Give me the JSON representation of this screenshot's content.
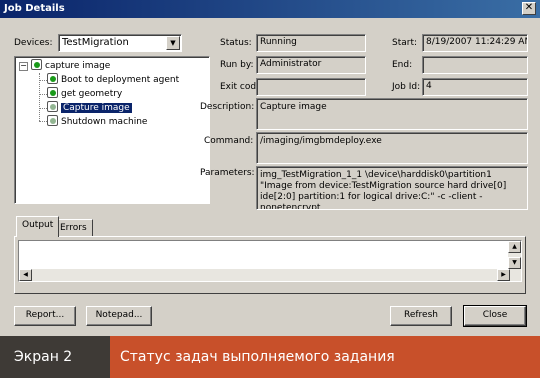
{
  "window": {
    "title": "Job Details",
    "close_glyph": "✕"
  },
  "devices": {
    "label": "Devices:",
    "selected": "TestMigration"
  },
  "tree": {
    "root": {
      "label": "capture image",
      "expander": "−"
    },
    "items": [
      {
        "label": "Boot to deployment agent",
        "state": "done"
      },
      {
        "label": "get geometry",
        "state": "done"
      },
      {
        "label": "Capture image",
        "state": "running",
        "selected": true
      },
      {
        "label": "Shutdown machine",
        "state": "pending"
      }
    ]
  },
  "fields": {
    "status_label": "Status:",
    "status_value": "Running",
    "runby_label": "Run by:",
    "runby_value": "Administrator",
    "exit_label": "Exit code:",
    "exit_value": "",
    "start_label": "Start:",
    "start_value": "8/19/2007 11:24:29 AM",
    "end_label": "End:",
    "end_value": "",
    "jobid_label": "Job Id:",
    "jobid_value": "4",
    "description_label": "Description:",
    "description_value": "Capture image",
    "command_label": "Command:",
    "command_value": "/imaging/imgbmdeploy.exe",
    "parameters_label": "Parameters:",
    "parameters_value": "img_TestMigration_1_1 \\device\\harddisk0\\partition1 \"Image from device:TestMigration source hard drive[0] ide[2:0] partition:1 for logical drive:C:\" -c -client -nonetencrypt"
  },
  "tabs": [
    {
      "label": "Output",
      "active": true
    },
    {
      "label": "Errors",
      "active": false
    }
  ],
  "buttons": {
    "report": "Report...",
    "notepad": "Notepad...",
    "refresh": "Refresh",
    "close": "Close"
  },
  "caption": {
    "screen": "Экран 2",
    "text": "Статус задач выполняемого задания"
  },
  "colors": {
    "caption_bg": "#c8502a",
    "caption_dark": "#3e3a36",
    "selection": "#0a246a"
  }
}
